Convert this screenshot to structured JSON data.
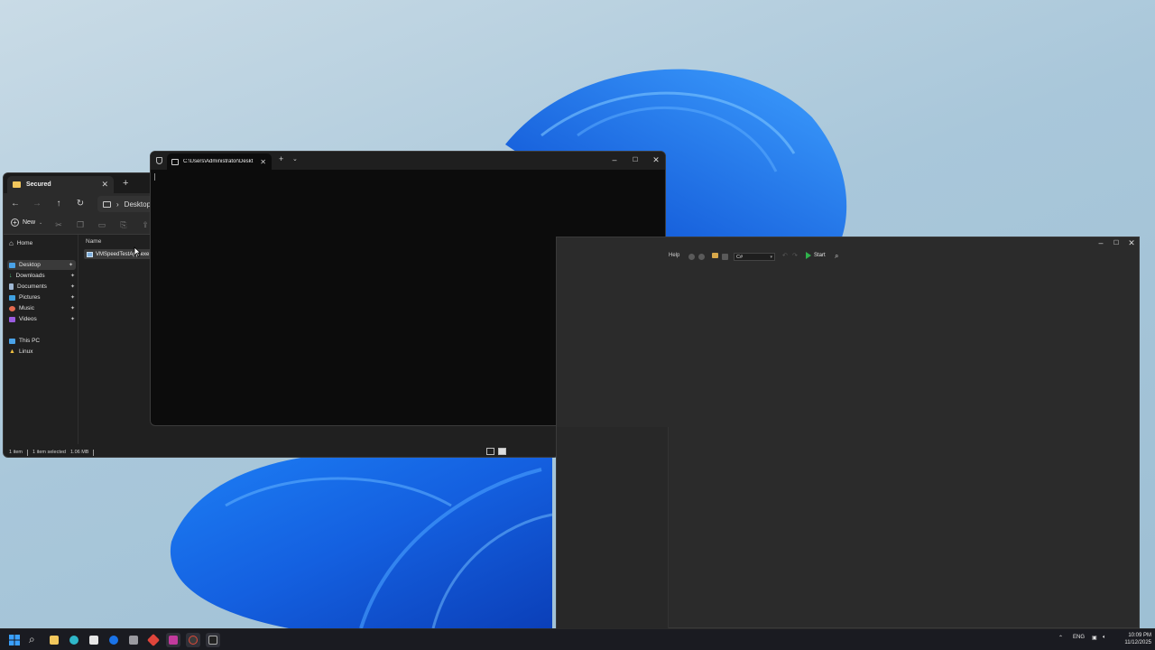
{
  "explorer": {
    "tab_title": "Secured",
    "breadcrumb": "Desktop",
    "new_label": "New",
    "sidebar": [
      {
        "label": "Home"
      },
      {
        "label": "Desktop"
      },
      {
        "label": "Downloads"
      },
      {
        "label": "Documents"
      },
      {
        "label": "Pictures"
      },
      {
        "label": "Music"
      },
      {
        "label": "Videos"
      },
      {
        "label": "This PC"
      },
      {
        "label": "Linux"
      }
    ],
    "column_name": "Name",
    "files": [
      {
        "name": "VMSpeedTestApp.exe"
      }
    ],
    "status": {
      "count": "1 item",
      "selected": "1 item selected",
      "size": "1.06 MB"
    }
  },
  "terminal": {
    "tab_title": "C:\\Users\\Administrator\\Deskt"
  },
  "ide": {
    "menu_help": "Help",
    "language": "C#",
    "start_label": "Start"
  },
  "taskbar": {
    "lang": "ENG",
    "time": "10:09 PM",
    "date": "11/12/2025"
  }
}
